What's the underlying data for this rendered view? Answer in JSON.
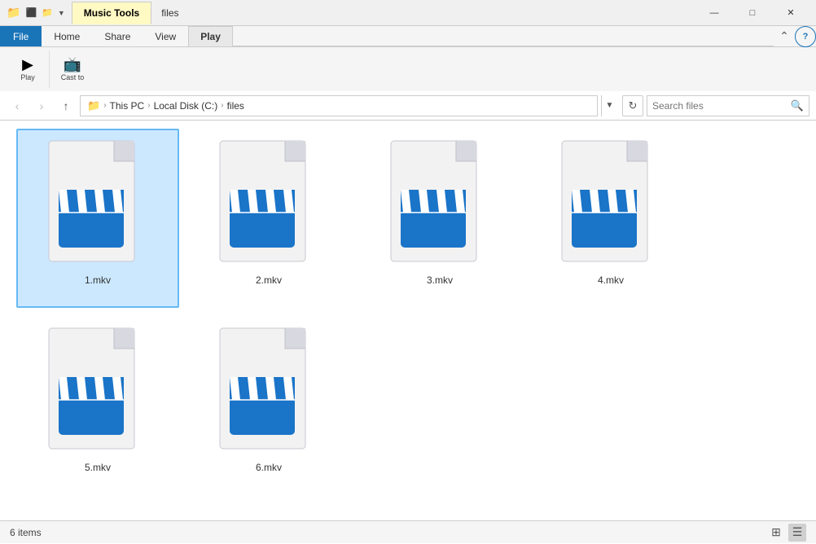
{
  "titleBar": {
    "folderName": "files",
    "activeTab": "Music Tools",
    "tabs": [
      "Music Tools"
    ],
    "windowControls": {
      "minimize": "—",
      "maximize": "□",
      "close": "✕"
    }
  },
  "ribbon": {
    "fileTab": "File",
    "tabs": [
      "Home",
      "Share",
      "View",
      "Play"
    ],
    "groups": []
  },
  "addressBar": {
    "back": "‹",
    "forward": "›",
    "up": "↑",
    "pathParts": [
      "This PC",
      "Local Disk (C:)",
      "files"
    ],
    "searchPlaceholder": "Search files",
    "searchIcon": "🔍"
  },
  "files": [
    {
      "name": "1.mkv",
      "selected": true
    },
    {
      "name": "2.mkv",
      "selected": false
    },
    {
      "name": "3.mkv",
      "selected": false
    },
    {
      "name": "4.mkv",
      "selected": false
    },
    {
      "name": "5.mkv",
      "selected": false
    },
    {
      "name": "6.mkv",
      "selected": false
    }
  ],
  "statusBar": {
    "itemCount": "6 items",
    "viewIcons": [
      "⊞",
      "☰"
    ]
  },
  "colors": {
    "fileBlue": "#1a74c8",
    "clapperBlue": "#1a74c8",
    "clapperStripe": "#ffffff",
    "pageBackground": "#f0f0f0",
    "pageFold": "#d0d0d8"
  }
}
